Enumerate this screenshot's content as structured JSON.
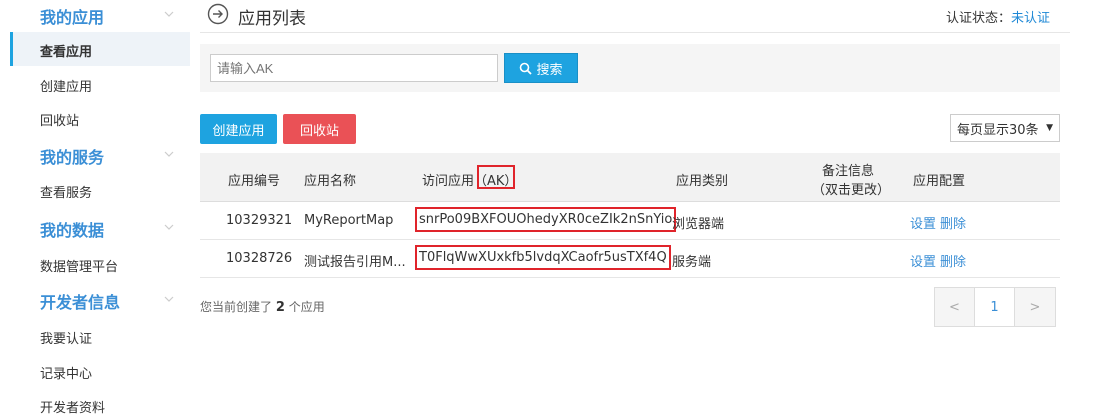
{
  "sidebar": {
    "sections": [
      {
        "title": "我的应用",
        "items": [
          "查看应用",
          "创建应用",
          "回收站"
        ]
      },
      {
        "title": "我的服务",
        "items": [
          "查看服务"
        ]
      },
      {
        "title": "我的数据",
        "items": [
          "数据管理平台"
        ]
      },
      {
        "title": "开发者信息",
        "items": [
          "我要认证",
          "记录中心",
          "开发者资料"
        ]
      }
    ],
    "active_item": "查看应用"
  },
  "header": {
    "title": "应用列表",
    "auth_label": "认证状态：",
    "auth_status": "未认证"
  },
  "search": {
    "placeholder": "请输入AK",
    "button_label": "搜索"
  },
  "toolbar": {
    "create_label": "创建应用",
    "recycle_label": "回收站",
    "per_page_label": "每页显示30条"
  },
  "table": {
    "columns": {
      "id": "应用编号",
      "name": "应用名称",
      "ak_prefix": "访问应用",
      "ak_highlight": "（AK）",
      "type": "应用类别",
      "remark_line1": "备注信息",
      "remark_line2": "（双击更改）",
      "config": "应用配置"
    },
    "rows": [
      {
        "id": "10329321",
        "name": "MyReportMap",
        "ak": "snrPo09BXFOUOhedyXR0ceZIk2nSnYio",
        "type": "浏览器端",
        "remark": "",
        "settings": "设置",
        "delete": "删除"
      },
      {
        "id": "10328726",
        "name": "测试报告引用M...",
        "ak": "T0FlqWwXUxkfb5lvdqXCaofr5usTXf4Q",
        "type": "服务端",
        "remark": "",
        "settings": "设置",
        "delete": "删除"
      }
    ]
  },
  "footer": {
    "count_prefix": "您当前创建了",
    "count": "2",
    "count_suffix": "个应用"
  },
  "pagination": {
    "prev": "<",
    "current": "1",
    "next": ">"
  },
  "colors": {
    "accent": "#1ea3e0",
    "danger": "#ea5156",
    "highlight_box": "#e0242b",
    "link": "#3b8fd6"
  }
}
